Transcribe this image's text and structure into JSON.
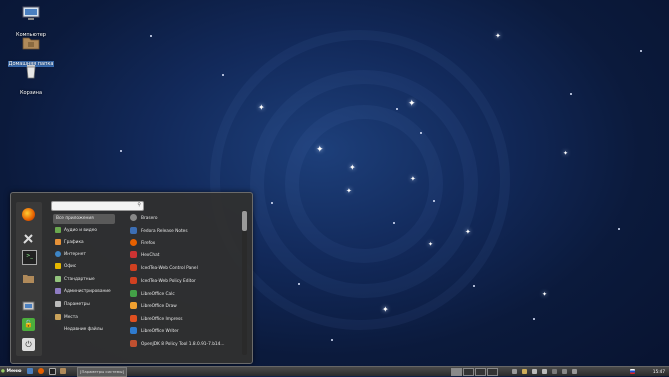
{
  "desktop": {
    "icons": [
      {
        "label": "Компьютер",
        "icon": "monitor-icon"
      },
      {
        "label": "Домашняя папка",
        "icon": "folder-icon",
        "selected": true
      },
      {
        "label": "Корзина",
        "icon": "trash-icon"
      }
    ]
  },
  "menu": {
    "search": {
      "value": "",
      "placeholder": ""
    },
    "favorites": [
      "firefox-icon",
      "settings-icon",
      "terminal-icon",
      "folder-icon",
      "logout-icon",
      "lock-icon",
      "power-icon"
    ],
    "categories": [
      {
        "label": "Все приложения",
        "active": true,
        "color": ""
      },
      {
        "label": "Аудио и видео",
        "color": "#6aa84f"
      },
      {
        "label": "Графика",
        "color": "#e69138"
      },
      {
        "label": "Интернет",
        "color": "#3d85c6"
      },
      {
        "label": "Офис",
        "color": "#e6b800"
      },
      {
        "label": "Стандартные",
        "color": "#93c47d"
      },
      {
        "label": "Администрирование",
        "color": "#8e7cc3"
      },
      {
        "label": "Параметры",
        "color": "#bbbbbb"
      },
      {
        "label": "Места",
        "color": "#c9a25b"
      },
      {
        "label": "Недавние файлы",
        "color": ""
      }
    ],
    "apps": [
      {
        "label": "Brasero",
        "color": "#888888"
      },
      {
        "label": "Fedora Release Notes",
        "color": "#3c6eb4"
      },
      {
        "label": "Firefox",
        "color": "#e66000"
      },
      {
        "label": "HexChat",
        "color": "#cc3333"
      },
      {
        "label": "IcedTea-Web Control Panel",
        "color": "#d04020"
      },
      {
        "label": "IcedTea-Web Policy Editor",
        "color": "#d04020"
      },
      {
        "label": "LibreOffice Calc",
        "color": "#43a047"
      },
      {
        "label": "LibreOffice Draw",
        "color": "#f0a030"
      },
      {
        "label": "LibreOffice Impress",
        "color": "#e05020"
      },
      {
        "label": "LibreOffice Writer",
        "color": "#2e7bcf"
      },
      {
        "label": "OpenJDK 8 Policy Tool 1.8.0.91-7.b14...",
        "color": "#c05030"
      }
    ]
  },
  "panel": {
    "menu_label": "Меню",
    "task_label": "[Параметры системы]",
    "clock": "15:47"
  }
}
